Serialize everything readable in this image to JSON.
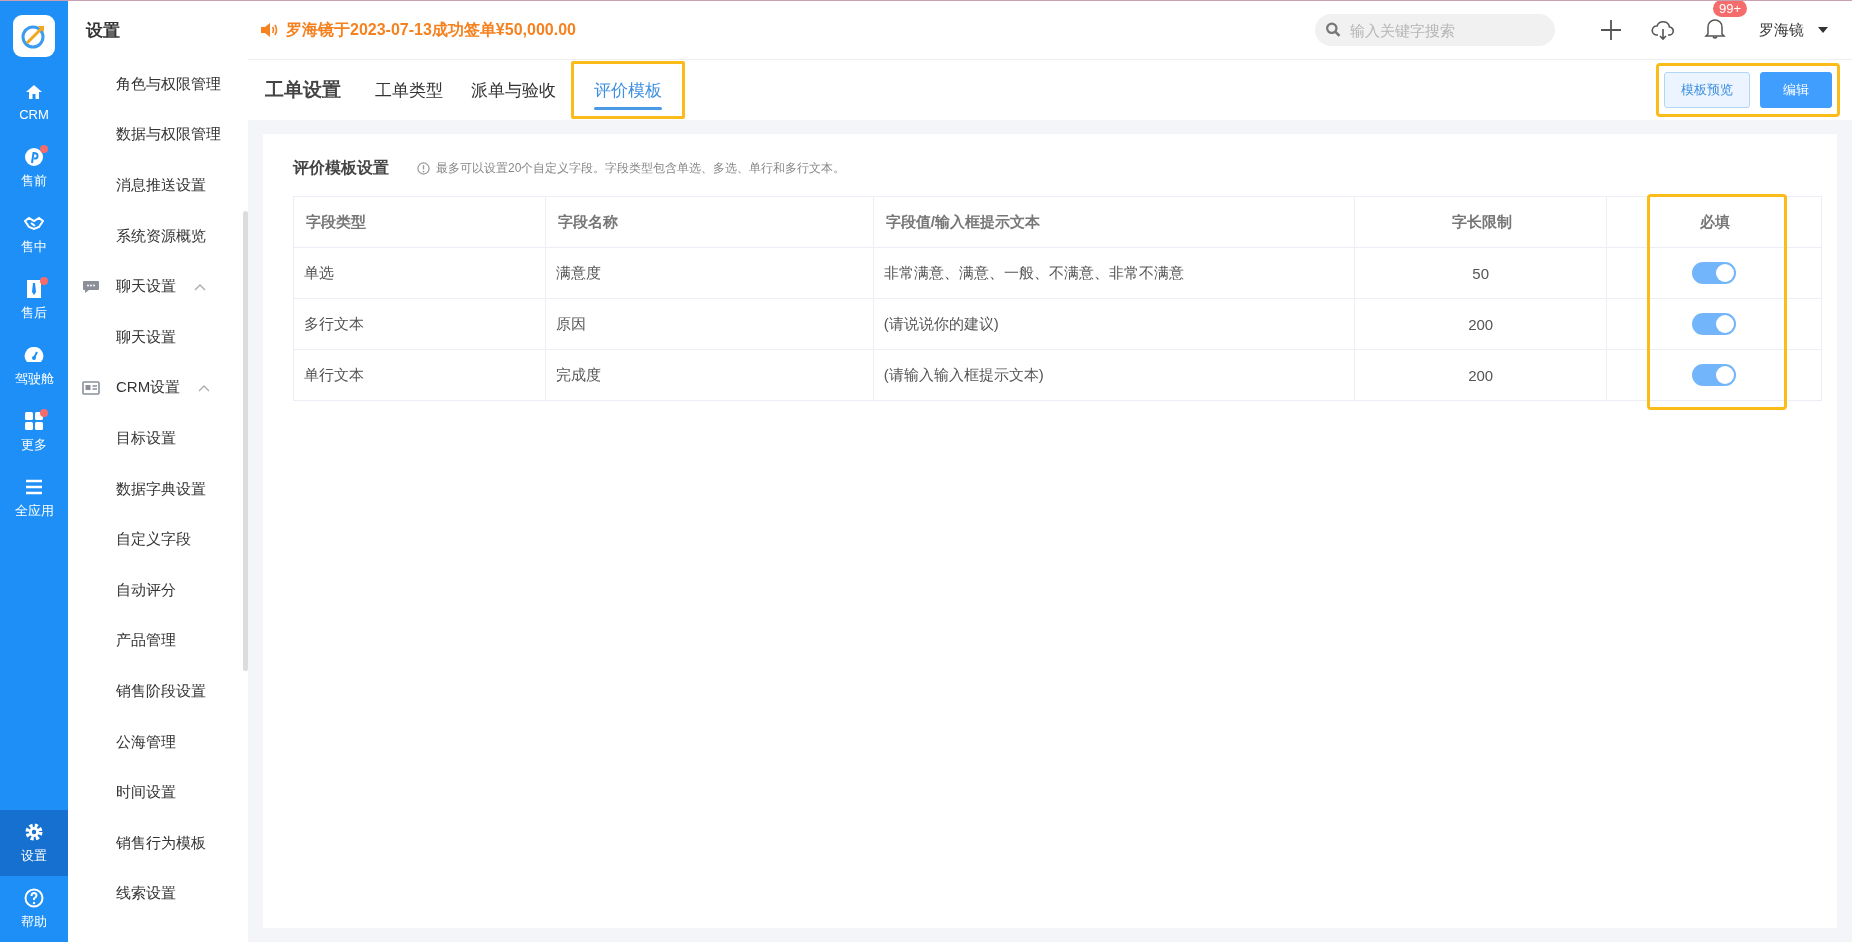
{
  "nav": {
    "items": [
      {
        "label": "CRM",
        "dot": false,
        "selected": false
      },
      {
        "label": "售前",
        "dot": true,
        "selected": false
      },
      {
        "label": "售中",
        "dot": false,
        "selected": false
      },
      {
        "label": "售后",
        "dot": true,
        "selected": false
      },
      {
        "label": "驾驶舱",
        "dot": false,
        "selected": false
      },
      {
        "label": "更多",
        "dot": true,
        "selected": false
      },
      {
        "label": "全应用",
        "dot": false,
        "selected": false
      }
    ],
    "bottom": [
      {
        "label": "设置",
        "dot": false,
        "selected": true
      },
      {
        "label": "帮助",
        "dot": false,
        "selected": false
      }
    ]
  },
  "sidebar": {
    "title": "设置",
    "items": [
      {
        "label": "角色与权限管理",
        "kind": "item"
      },
      {
        "label": "数据与权限管理",
        "kind": "item"
      },
      {
        "label": "消息推送设置",
        "kind": "item"
      },
      {
        "label": "系统资源概览",
        "kind": "item"
      },
      {
        "label": "聊天设置",
        "kind": "group",
        "expanded": true
      },
      {
        "label": "聊天设置",
        "kind": "item"
      },
      {
        "label": "CRM设置",
        "kind": "group",
        "expanded": true
      },
      {
        "label": "目标设置",
        "kind": "item"
      },
      {
        "label": "数据字典设置",
        "kind": "item"
      },
      {
        "label": "自定义字段",
        "kind": "item"
      },
      {
        "label": "自动评分",
        "kind": "item"
      },
      {
        "label": "产品管理",
        "kind": "item"
      },
      {
        "label": "销售阶段设置",
        "kind": "item"
      },
      {
        "label": "公海管理",
        "kind": "item"
      },
      {
        "label": "时间设置",
        "kind": "item"
      },
      {
        "label": "销售行为模板",
        "kind": "item"
      },
      {
        "label": "线索设置",
        "kind": "item"
      }
    ]
  },
  "topbar": {
    "notice": "罗海镜于2023-07-13成功签单¥50,000.00",
    "search": {
      "placeholder": "输入关键字搜索"
    },
    "notifications": "99+",
    "user": "罗海镜"
  },
  "page": {
    "title": "工单设置",
    "tabs": [
      {
        "label": "工单类型",
        "selected": false,
        "highlighted": false
      },
      {
        "label": "派单与验收",
        "selected": false,
        "highlighted": false
      },
      {
        "label": "评价模板",
        "selected": true,
        "highlighted": true
      }
    ],
    "actions": {
      "highlighted": true,
      "buttons": [
        {
          "label": "模板预览",
          "kind": "secondary"
        },
        {
          "label": "编辑",
          "kind": "primary"
        }
      ]
    }
  },
  "section": {
    "title": "评价模板设置",
    "note": "最多可以设置20个自定义字段。字段类型包含单选、多选、单行和多行文本。"
  },
  "table": {
    "columns": [
      {
        "label": "字段类型",
        "highlighted": false
      },
      {
        "label": "字段名称",
        "highlighted": false
      },
      {
        "label": "字段值/输入框提示文本",
        "highlighted": false
      },
      {
        "label": "字长限制",
        "highlighted": false
      },
      {
        "label": "必填",
        "highlighted": true
      }
    ],
    "rows": [
      {
        "type": "单选",
        "name": "满意度",
        "values": "非常满意、满意、一般、不满意、非常不满意",
        "limit": "50",
        "required": true
      },
      {
        "type": "多行文本",
        "name": "原因",
        "values": "(请说说你的建议)",
        "limit": "200",
        "required": true
      },
      {
        "type": "单行文本",
        "name": "完成度",
        "values": "(请输入输入框提示文本)",
        "limit": "200",
        "required": true
      }
    ]
  }
}
